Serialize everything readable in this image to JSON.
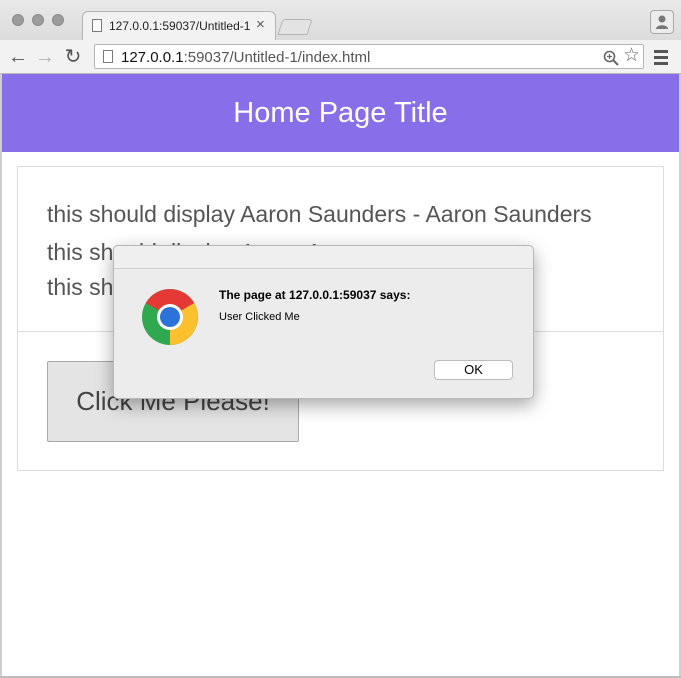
{
  "browser": {
    "tab": {
      "title": "127.0.0.1:59037/Untitled-1"
    },
    "address_bar": {
      "host": "127.0.0.1",
      "rest": ":59037/Untitled-1/index.html"
    }
  },
  "page": {
    "header": {
      "title": "Home Page Title"
    },
    "card": {
      "lines": [
        "this should display Aaron Saunders - Aaron Saunders",
        "this should display Aaron Aaron",
        "this should display Saunders"
      ],
      "button_label": "Click Me Please!"
    }
  },
  "dialog": {
    "heading": "The page at 127.0.0.1:59037 says:",
    "message": "User Clicked Me",
    "ok_label": "OK"
  },
  "colors": {
    "header_bg": "#886ee9",
    "header_text": "#ffffff"
  },
  "icons": [
    "page-icon",
    "close-icon",
    "back-arrow-icon",
    "forward-arrow-icon",
    "reload-icon",
    "zoom-icon",
    "star-icon",
    "menu-icon",
    "profile-icon",
    "chrome-logo-icon"
  ]
}
